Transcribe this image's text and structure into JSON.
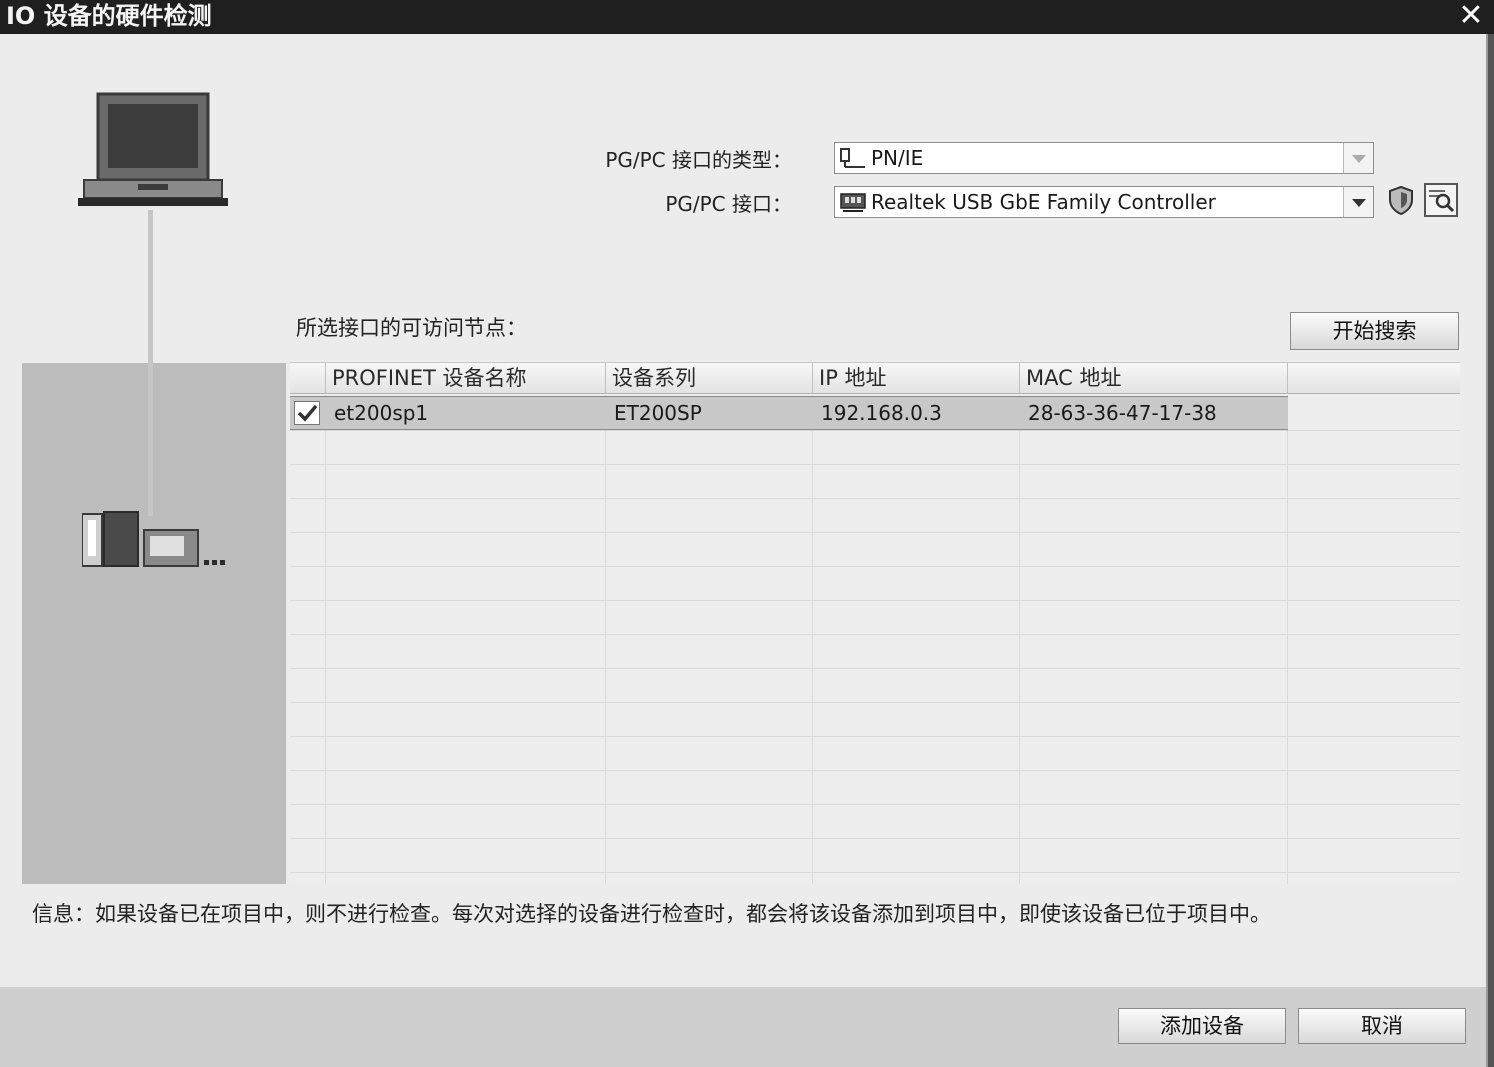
{
  "window": {
    "title": "IO 设备的硬件检测",
    "close_glyph": "✕"
  },
  "interface_type": {
    "label": "PG/PC 接口的类型：",
    "value": "PN/IE"
  },
  "interface": {
    "label": "PG/PC 接口：",
    "value": "Realtek USB GbE Family Controller"
  },
  "nodes_section": {
    "label": "所选接口的可访问节点：",
    "search_button": "开始搜索"
  },
  "table": {
    "columns": [
      "PROFINET 设备名称",
      "设备系列",
      "IP 地址",
      "MAC 地址"
    ],
    "rows": [
      {
        "checked": true,
        "name": "et200sp1",
        "family": "ET200SP",
        "ip": "192.168.0.3",
        "mac": "28-63-36-47-17-38"
      }
    ]
  },
  "info": "信息：如果设备已在项目中，则不进行检查。每次对选择的设备进行检查时，都会将该设备添加到项目中，即使该设备已位于项目中。",
  "footer": {
    "add_button": "添加设备",
    "cancel_button": "取消"
  },
  "icons": {
    "laptop": "laptop-icon",
    "device": "plc-device-icon",
    "network": "network-icon",
    "nic": "network-card-icon",
    "diagnostics": "shield-icon",
    "properties": "magnifier-icon",
    "check": "checkmark-icon"
  }
}
